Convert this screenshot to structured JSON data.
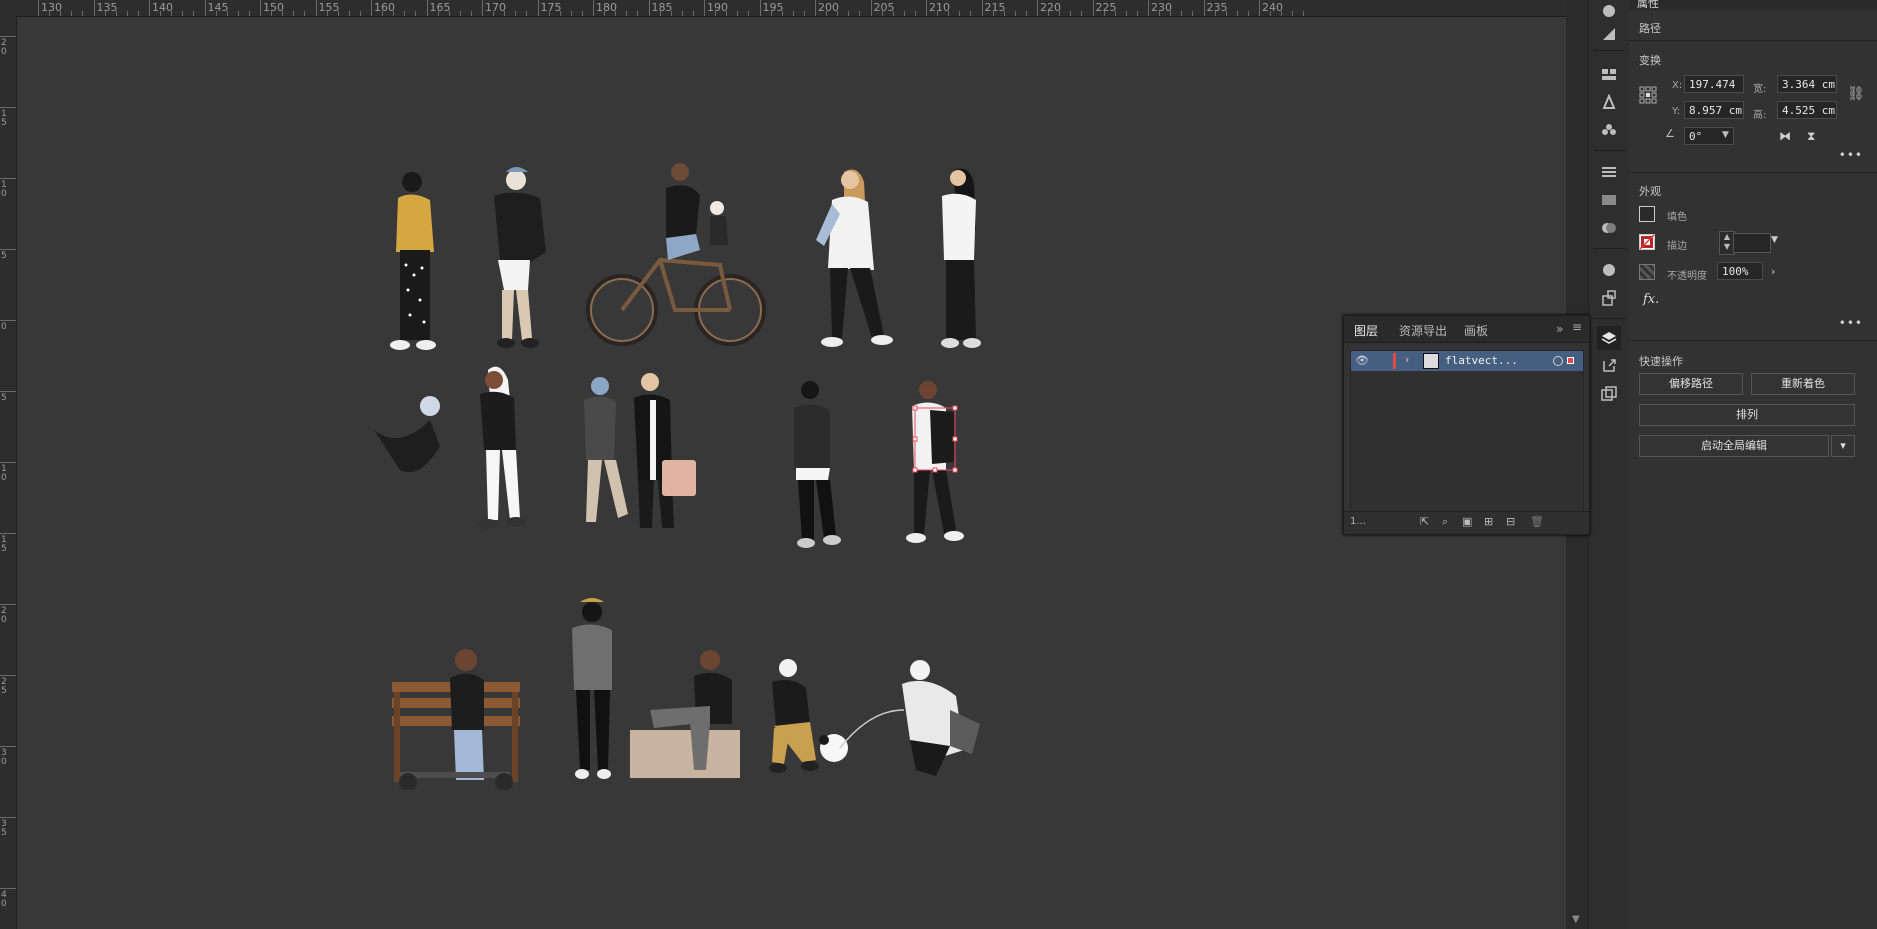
{
  "ruler": {
    "top_labels": [
      "130",
      "135",
      "140",
      "145",
      "150",
      "155",
      "160",
      "165",
      "170",
      "175",
      "180",
      "185",
      "190",
      "195",
      "200",
      "205",
      "210",
      "215",
      "220",
      "225",
      "230",
      "235",
      "240"
    ],
    "left_labels": [
      "20",
      "15",
      "10",
      "5",
      "0",
      "5",
      "10",
      "15",
      "20",
      "25",
      "30",
      "35",
      "40"
    ]
  },
  "layers_panel": {
    "tabs": [
      "图层",
      "资源导出",
      "画板"
    ],
    "layer_name": "flatvect...",
    "footer_count": "1..."
  },
  "properties": {
    "top_tab": "属性",
    "path_label": "路径",
    "transform": {
      "title": "变换",
      "x_label": "X:",
      "x_value": "197.474",
      "y_label": "Y:",
      "y_value": "8.957 cm",
      "w_label": "宽:",
      "w_value": "3.364 cm",
      "h_label": "高:",
      "h_value": "4.525 cm",
      "angle_value": "0°"
    },
    "appearance": {
      "title": "外观",
      "fill_label": "填色",
      "stroke_label": "描边",
      "opacity_label": "不透明度",
      "opacity_value": "100%",
      "fx_label": "fx."
    },
    "quick_actions": {
      "title": "快速操作",
      "offset_path": "偏移路径",
      "recolor": "重新着色",
      "arrange": "排列",
      "global_edit": "启动全局编辑"
    }
  },
  "colors": {
    "canvas": "#383838",
    "panel": "#323232",
    "selection": "#465f80",
    "layer_color": "#e24a4a"
  }
}
